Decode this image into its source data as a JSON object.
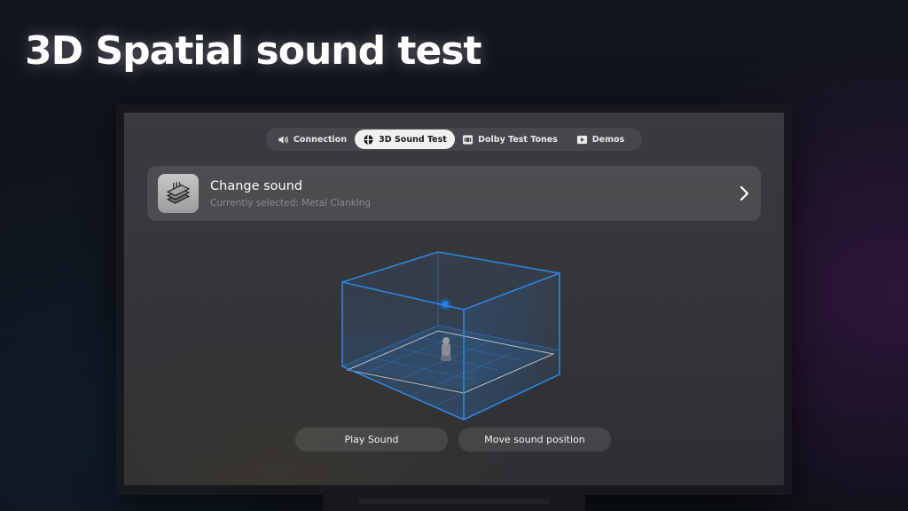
{
  "headline": "3D Spatial sound test",
  "tabs": [
    {
      "label": "Connection",
      "icon": "speaker-icon",
      "active": false
    },
    {
      "label": "3D Sound Test",
      "icon": "sphere-icon",
      "active": true
    },
    {
      "label": "Dolby Test Tones",
      "icon": "dolby-icon",
      "active": false
    },
    {
      "label": "Demos",
      "icon": "play-icon",
      "active": false
    }
  ],
  "sound_card": {
    "title": "Change sound",
    "subtitle": "Currently selected: Metal Clanking",
    "thumbnail_icon": "metal-plates-icon",
    "chevron_icon": "chevron-right-icon"
  },
  "room_visual": {
    "edge_color": "#2f86e0",
    "source_color": "#1a7fe8",
    "listener_icon": "listener-figure-icon"
  },
  "buttons": {
    "play": "Play Sound",
    "move": "Move sound position"
  }
}
